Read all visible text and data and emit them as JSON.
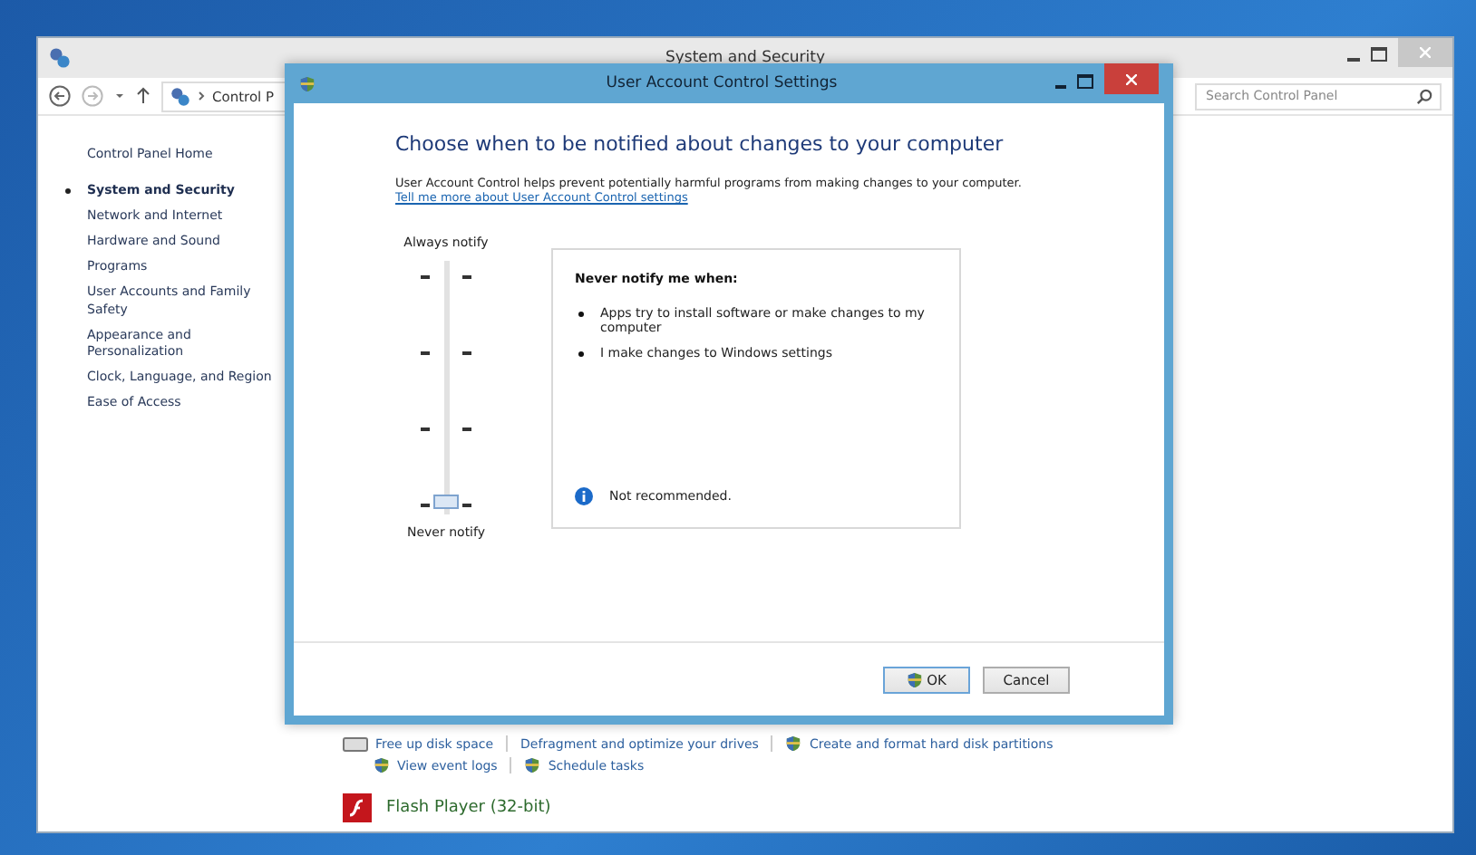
{
  "control_panel": {
    "title": "System and Security",
    "breadcrumb": "Control P",
    "search": {
      "placeholder": "Search Control Panel"
    }
  },
  "sidebar": {
    "items": [
      {
        "label": "Control Panel Home",
        "selected": false
      },
      {
        "label": "System and Security",
        "selected": true
      },
      {
        "label": "Network and Internet",
        "selected": false
      },
      {
        "label": "Hardware and Sound",
        "selected": false
      },
      {
        "label": "Programs",
        "selected": false
      },
      {
        "label": "User Accounts and Family Safety",
        "selected": false
      },
      {
        "label": "Appearance and Personalization",
        "selected": false
      },
      {
        "label": "Clock, Language, and Region",
        "selected": false
      },
      {
        "label": "Ease of Access",
        "selected": false
      }
    ]
  },
  "content": {
    "link_rows": [
      [
        {
          "label": "Free up disk space",
          "kind": "disk"
        },
        {
          "label": "Defragment and optimize your drives",
          "kind": "plain"
        },
        {
          "label": "Create and format hard disk partitions",
          "kind": "shield"
        }
      ],
      [
        {
          "label": "View event logs",
          "kind": "shield"
        },
        {
          "label": "Schedule tasks",
          "kind": "shield"
        }
      ]
    ],
    "program": "Flash Player (32-bit)"
  },
  "dialog": {
    "title": "User Account Control Settings",
    "heading": "Choose when to be notified about changes to your computer",
    "description": "User Account Control helps prevent potentially harmful programs from making changes to your computer.",
    "link": "Tell me more about User Account Control settings",
    "slider": {
      "top_label": "Always notify",
      "bottom_label": "Never notify",
      "level": 0
    },
    "info_panel": {
      "heading": "Never notify me when:",
      "bullets": [
        "Apps try to install software or make changes to my computer",
        "I make changes to Windows settings"
      ],
      "note": "Not recommended."
    },
    "buttons": [
      {
        "label": "OK",
        "kind": "shield"
      },
      {
        "label": "Cancel",
        "kind": "plain"
      }
    ]
  }
}
